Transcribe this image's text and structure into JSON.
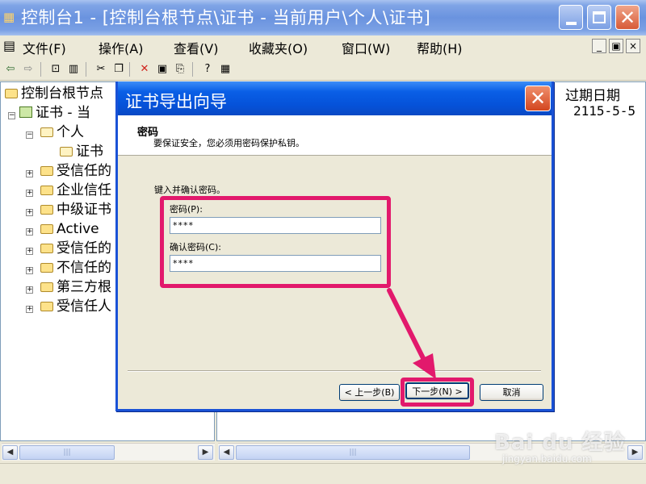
{
  "main_window": {
    "title": "控制台1 - [控制台根节点\\证书 - 当前用户\\个人\\证书]"
  },
  "menu": [
    "文件(F)",
    "操作(A)",
    "查看(V)",
    "收藏夹(O)",
    "窗口(W)",
    "帮助(H)"
  ],
  "mdi_buttons": [
    "_",
    "▣",
    "×"
  ],
  "tree": [
    {
      "label": "控制台根节点",
      "indent": 0,
      "icon": "folder-icon",
      "expander": ""
    },
    {
      "label": "证书 - 当",
      "indent": 1,
      "icon": "certificate-store-icon",
      "expander": "-"
    },
    {
      "label": "个人",
      "indent": 2,
      "icon": "folder-open-icon",
      "expander": "-"
    },
    {
      "label": "证书",
      "indent": 3,
      "icon": "folder-open-icon",
      "expander": ""
    },
    {
      "label": "受信任的",
      "indent": 2,
      "icon": "folder-icon",
      "expander": "+"
    },
    {
      "label": "企业信任",
      "indent": 2,
      "icon": "folder-icon",
      "expander": "+"
    },
    {
      "label": "中级证书",
      "indent": 2,
      "icon": "folder-icon",
      "expander": "+"
    },
    {
      "label": "Active",
      "indent": 2,
      "icon": "folder-icon",
      "expander": "+"
    },
    {
      "label": "受信任的",
      "indent": 2,
      "icon": "folder-icon",
      "expander": "+"
    },
    {
      "label": "不信任的",
      "indent": 2,
      "icon": "folder-icon",
      "expander": "+"
    },
    {
      "label": "第三方根",
      "indent": 2,
      "icon": "folder-icon",
      "expander": "+"
    },
    {
      "label": "受信任人",
      "indent": 2,
      "icon": "folder-icon",
      "expander": "+"
    }
  ],
  "list": {
    "column_header": "过期日期",
    "rows": [
      {
        "expiry": "2115-5-5"
      }
    ]
  },
  "dialog": {
    "title": "证书导出向导",
    "header_title": "密码",
    "header_subtitle": "要保证安全，您必须用密码保护私钥。",
    "instruction": "键入并确认密码。",
    "password_label": "密码(P):",
    "password_value": "****",
    "confirm_label": "确认密码(C):",
    "confirm_value": "****",
    "back_button": "< 上一步(B)",
    "next_button": "下一步(N) >",
    "cancel_button": "取消",
    "highlight_color": "#e2196c"
  },
  "watermark": {
    "brand": "Bai du 经验",
    "url": "jingyan.baidu.com"
  }
}
